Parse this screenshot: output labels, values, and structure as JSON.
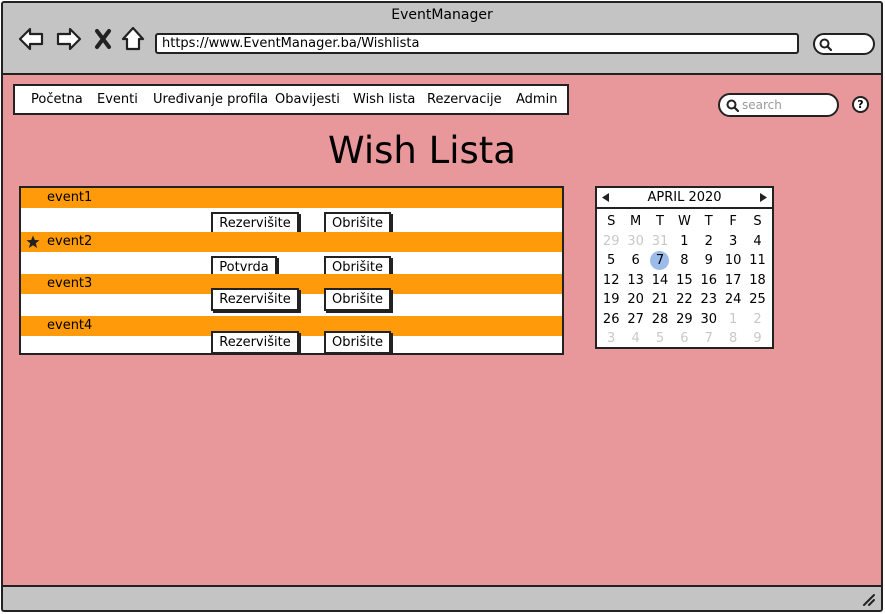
{
  "browser": {
    "window_title": "EventManager",
    "url": "https://www.EventManager.ba/Wishlista"
  },
  "menu": {
    "items": [
      "Početna",
      "Eventi",
      "Uređivanje profila",
      "Obavijesti",
      "Wish lista",
      "Rezervacije",
      "Admin"
    ]
  },
  "search": {
    "placeholder": "search"
  },
  "help": {
    "label": "?"
  },
  "page": {
    "title": "Wish Lista"
  },
  "wishlist": {
    "events": [
      {
        "name": "event1",
        "starred": false
      },
      {
        "name": "event2",
        "starred": true
      },
      {
        "name": "event3",
        "starred": false
      },
      {
        "name": "event4",
        "starred": false
      }
    ],
    "buttons": {
      "reserve": "Rezervišite",
      "delete": "Obrišite",
      "confirm": "Potvrda"
    }
  },
  "calendar": {
    "month_label": "APRIL 2020",
    "weekdays": [
      "S",
      "M",
      "T",
      "W",
      "T",
      "F",
      "S"
    ],
    "selected_day": "7",
    "weeks": [
      [
        "29",
        "30",
        "31",
        "1",
        "2",
        "3",
        "4"
      ],
      [
        "5",
        "6",
        "7",
        "8",
        "9",
        "10",
        "11"
      ],
      [
        "12",
        "13",
        "14",
        "15",
        "16",
        "17",
        "18"
      ],
      [
        "19",
        "20",
        "21",
        "22",
        "23",
        "24",
        "25"
      ],
      [
        "26",
        "27",
        "28",
        "29",
        "30",
        "1",
        "2"
      ],
      [
        "3",
        "4",
        "5",
        "6",
        "7",
        "8",
        "9"
      ]
    ]
  }
}
